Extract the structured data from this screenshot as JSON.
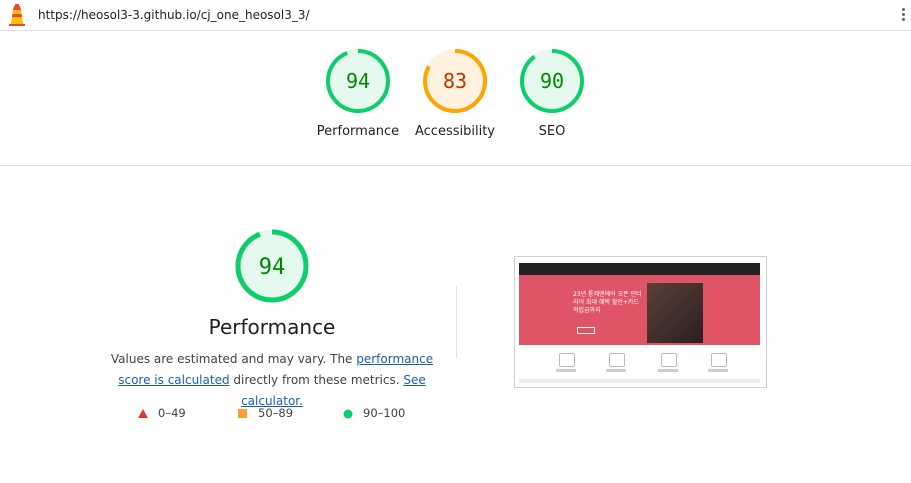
{
  "topbar": {
    "url": "https://heosol3-3.github.io/cj_one_heosol3_3/",
    "logo_icon": "lighthouse-icon",
    "menu_icon": "kebab-menu-icon"
  },
  "summary": {
    "gauges": [
      {
        "score": 94,
        "label": "Performance",
        "status": "pass"
      },
      {
        "score": 83,
        "label": "Accessibility",
        "status": "average"
      },
      {
        "score": 90,
        "label": "SEO",
        "status": "pass"
      }
    ]
  },
  "performance": {
    "score": 94,
    "title": "Performance",
    "desc_prefix": "Values are estimated and may vary. The ",
    "desc_link1": "performance score is calculated",
    "desc_middle": " directly from these metrics. ",
    "desc_link2": "See calculator."
  },
  "legend": [
    {
      "range": "0–49",
      "shape": "triangle",
      "color": "#e53935"
    },
    {
      "range": "50–89",
      "shape": "square",
      "color": "#fb9f35"
    },
    {
      "range": "90–100",
      "shape": "circle",
      "color": "#0cce6b"
    }
  ],
  "colors": {
    "pass": "#0cce6b",
    "pass_text": "#008800",
    "pass_bg": "#e6f9ee",
    "average": "#ffa400",
    "average_text": "#c33300",
    "average_bg": "#fff3e0"
  },
  "thumbnail": {
    "hero_text": "23년 통제엔에어 오픈 인더리어 최대 혜택 할인+카드 적립금까지"
  }
}
